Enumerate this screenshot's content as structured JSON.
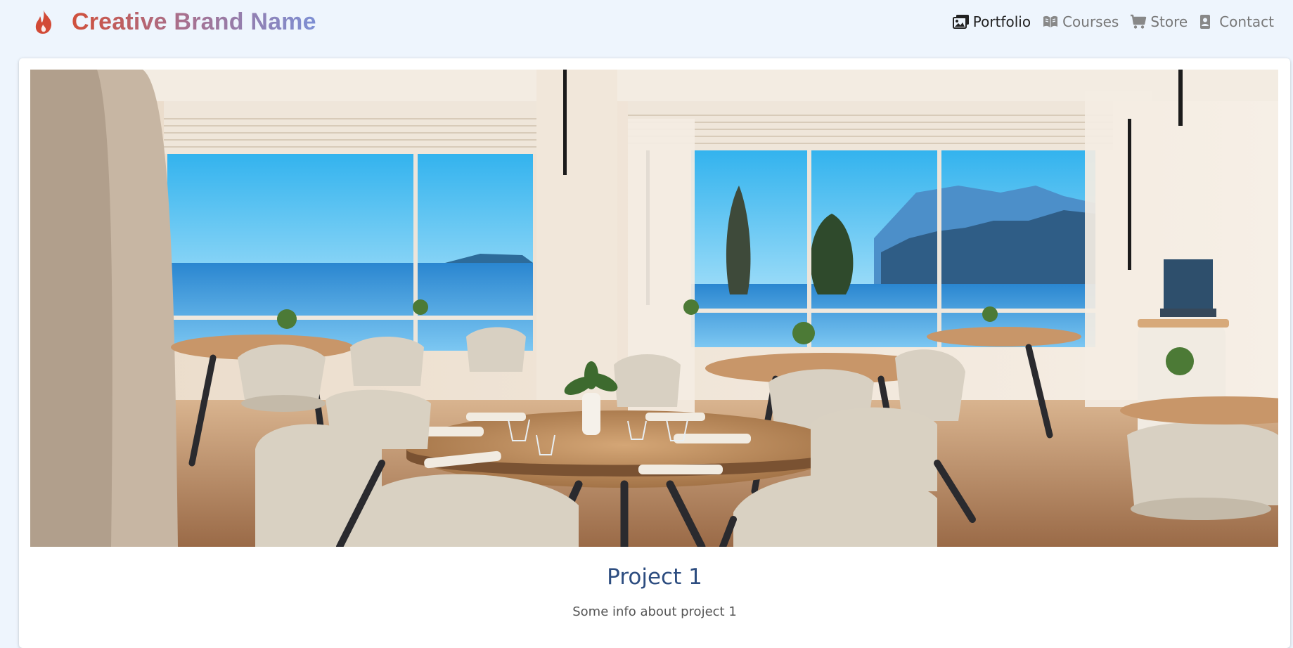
{
  "brand": {
    "name": "Creative Brand Name",
    "logo_icon": "flame-icon"
  },
  "nav": {
    "items": [
      {
        "label": "Portfolio",
        "icon": "photo-gallery-icon",
        "active": true
      },
      {
        "label": "Courses",
        "icon": "book-open-icon",
        "active": false
      },
      {
        "label": "Store",
        "icon": "shopping-cart-icon",
        "active": false
      },
      {
        "label": "Contact",
        "icon": "contact-card-icon",
        "active": false
      }
    ]
  },
  "project": {
    "image_description": "Restaurant dining room with sea view",
    "title": "Project 1",
    "text": "Some info about project 1"
  },
  "colors": {
    "background": "#eef5fd",
    "brand_gradient_start": "#d0503c",
    "brand_gradient_end": "#7d8fd4",
    "title": "#2d4d80",
    "nav_active": "#222222",
    "nav_inactive": "#777777"
  }
}
